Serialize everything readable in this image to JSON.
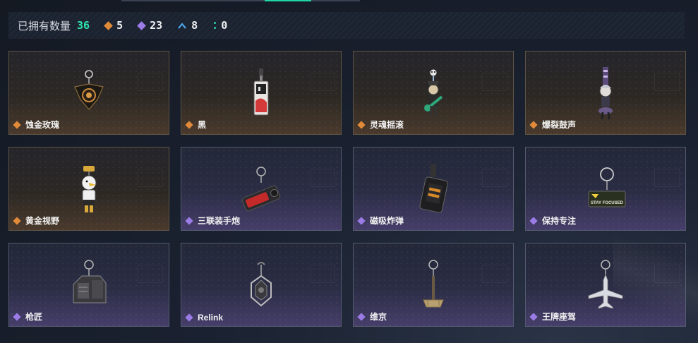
{
  "header": {
    "owned_label": "已拥有数量",
    "owned_count": "36",
    "stats": [
      {
        "icon": "gold-rarity-icon",
        "value": "5",
        "color": "#e08a3a"
      },
      {
        "icon": "purple-rarity-icon",
        "value": "23",
        "color": "#9b7ce6"
      },
      {
        "icon": "blue-rarity-icon",
        "value": "8",
        "color": "#4aa3e8"
      },
      {
        "icon": "green-rarity-icon",
        "value": "0",
        "color": "#29d5a8"
      }
    ]
  },
  "colors": {
    "accent": "#2ee6ae",
    "gold": "#e08a3a",
    "purple": "#9b7ce6"
  },
  "items": [
    {
      "name": "蚀金玫瑰",
      "rarity": "gold",
      "icon": "rose-charm-icon"
    },
    {
      "name": "黑",
      "rarity": "gold",
      "icon": "card-charm-icon"
    },
    {
      "name": "灵魂摇滚",
      "rarity": "gold",
      "icon": "guitar-figure-charm-icon"
    },
    {
      "name": "爆裂鼓声",
      "rarity": "gold",
      "icon": "drummer-figure-charm-icon"
    },
    {
      "name": "黄金视野",
      "rarity": "gold",
      "icon": "eagle-figure-charm-icon"
    },
    {
      "name": "三联装手炮",
      "rarity": "purple",
      "icon": "hand-cannon-charm-icon"
    },
    {
      "name": "磁吸炸弹",
      "rarity": "purple",
      "icon": "magnet-bomb-charm-icon"
    },
    {
      "name": "保持专注",
      "rarity": "purple",
      "icon": "stay-focused-tag-icon"
    },
    {
      "name": "枪匠",
      "rarity": "purple",
      "icon": "gunsmith-tag-icon"
    },
    {
      "name": "Relink",
      "rarity": "purple",
      "icon": "relink-charm-icon"
    },
    {
      "name": "维京",
      "rarity": "purple",
      "icon": "viking-hammer-charm-icon"
    },
    {
      "name": "王牌座驾",
      "rarity": "purple",
      "icon": "jet-plane-charm-icon"
    }
  ],
  "tag_text": "STAY FOCUSED"
}
